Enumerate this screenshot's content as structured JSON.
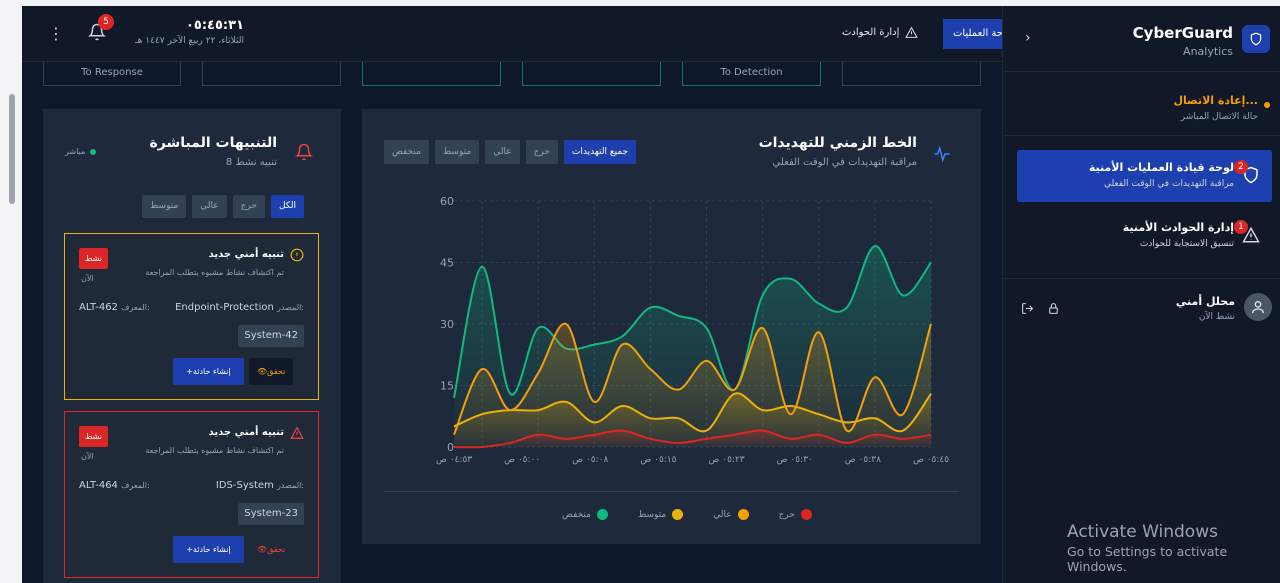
{
  "header": {
    "time": "٠٥:٤٥:٣١",
    "date": "الثلاثاء، ٢٢ ربيع الآخر ١٤٤٧ هـ",
    "notification_count": "5",
    "nav_incidents": "إدارة الحوادث",
    "nav_operations": "حة العمليات"
  },
  "stat_cards": [
    "To Response",
    "",
    "",
    "",
    "To Detection",
    ""
  ],
  "sidebar": {
    "brand_name": "CyberGuard",
    "brand_sub": "Analytics",
    "connection_title": "إعادة الاتصال...",
    "connection_sub": "حالة الاتصال المباشر",
    "items": [
      {
        "label": "لوحة قيادة العمليات الأمنية",
        "sub": "مراقبة التهديدات في الوقت الفعلي",
        "badge": "2"
      },
      {
        "label": "إدارة الحوادث الأمنية",
        "sub": "تنسيق الاستجابة للحوادث",
        "badge": "1"
      }
    ],
    "user_name": "محلل أمني",
    "user_status": "نشط الآن"
  },
  "alerts": {
    "title": "التنبيهات المباشرة",
    "count": "8 تنبيه نشط",
    "live": "مباشر",
    "filters": [
      "الكل",
      "حرج",
      "عالي",
      "متوسط"
    ],
    "cards": [
      {
        "title": "تنبيه أمني جديد",
        "desc": "تم اكتشاف نشاط مشبوه يتطلب المراجعة",
        "status": "نشط",
        "time": "الآن",
        "source_label": "المصدر:",
        "source": "Endpoint-Protection",
        "id_label": "المعرف:",
        "id": "ALT-462",
        "system": "System-42",
        "verify": "تحقق",
        "create": "إنشاء حادثة"
      },
      {
        "title": "تنبيه أمني جديد",
        "desc": "تم اكتشاف نشاط مشبوه يتطلب المراجعة",
        "status": "نشط",
        "time": "الآن",
        "source_label": "المصدر:",
        "source": "IDS-System",
        "id_label": "المعرف:",
        "id": "ALT-464",
        "system": "System-23",
        "verify": "تحقق",
        "create": "إنشاء حادثة"
      }
    ]
  },
  "chart_panel": {
    "title": "الخط الزمني للتهديدات",
    "subtitle": "مراقبة التهديدات في الوقت الفعلي",
    "filters": [
      "جميع التهديدات",
      "حرج",
      "عالي",
      "متوسط",
      "منخفض"
    ]
  },
  "chart_data": {
    "type": "area",
    "x": [
      "٠٥:٤٥ ص",
      "٠٥:٣٨ ص",
      "٠٥:٣٠ ص",
      "٠٥:٢٣ ص",
      "٠٥:١٥ ص",
      "٠٥:٠٨ ص",
      "٠٥:٠٠ ص",
      "٠٤:٥٣ ص"
    ],
    "ylim": [
      0,
      60
    ],
    "yticks": [
      0,
      15,
      30,
      45,
      60
    ],
    "grid": true,
    "series": [
      {
        "name": "حرج",
        "color": "#dc2626",
        "values": [
          3,
          2,
          3,
          1,
          3,
          2,
          4,
          3,
          2,
          1,
          2,
          4,
          3,
          2,
          3,
          1,
          0,
          0
        ]
      },
      {
        "name": "عالي",
        "color": "#f59e0b",
        "values": [
          30,
          8,
          17,
          4,
          28,
          8,
          29,
          14,
          21,
          14,
          19,
          25,
          11,
          30,
          18,
          9,
          19,
          3
        ]
      },
      {
        "name": "متوسط",
        "color": "#eab308",
        "values": [
          13,
          4,
          7,
          6,
          8,
          10,
          9,
          13,
          4,
          7,
          7,
          10,
          6,
          11,
          9,
          9,
          8,
          5
        ]
      },
      {
        "name": "منخفض",
        "color": "#10b981",
        "values": [
          45,
          37,
          49,
          34,
          35,
          41,
          37,
          14,
          29,
          32,
          34,
          27,
          25,
          24,
          29,
          13,
          44,
          12
        ]
      }
    ]
  },
  "legend": [
    "حرج",
    "عالي",
    "متوسط",
    "منخفض"
  ]
}
